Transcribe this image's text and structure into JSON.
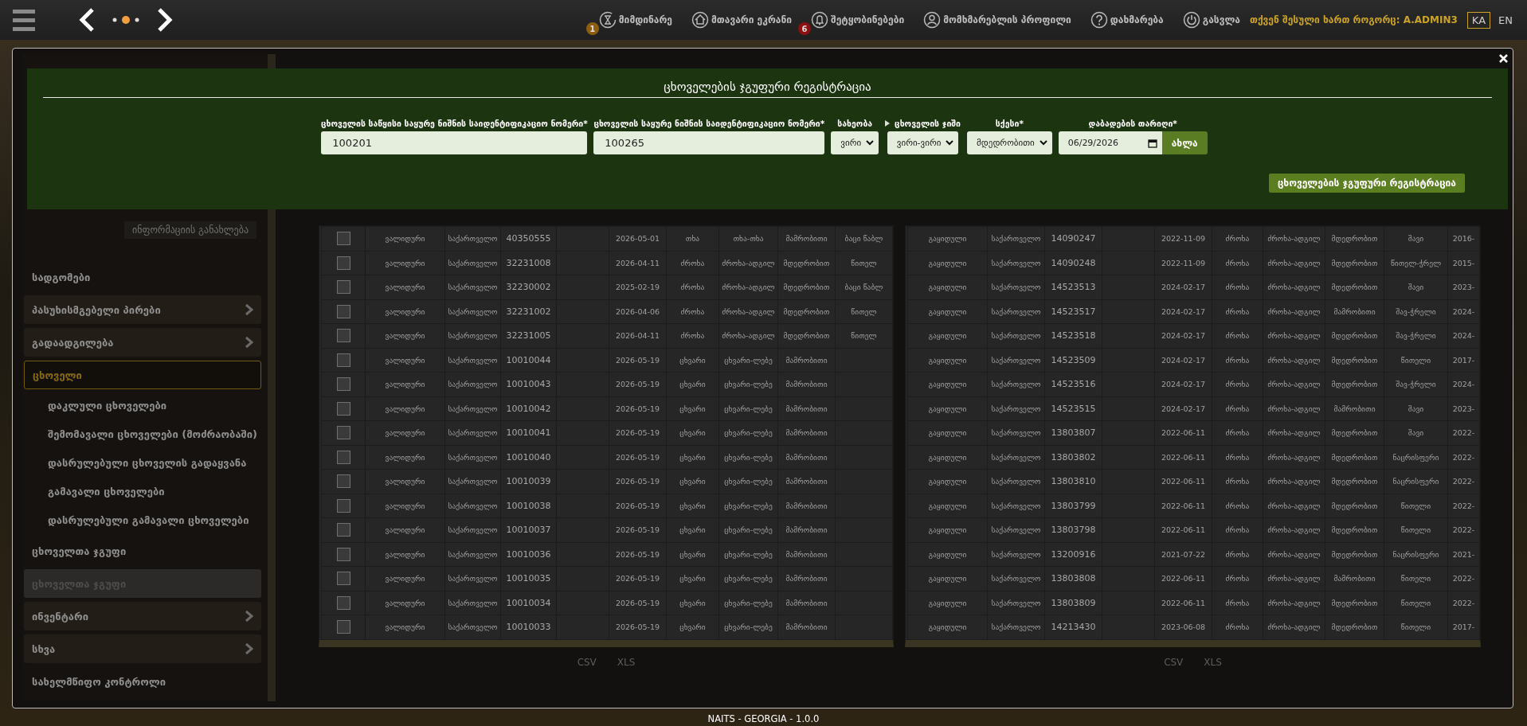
{
  "header": {
    "nav": [
      {
        "label": "მიმდინარე",
        "badge": {
          "text": "1",
          "color": "#8b5e12"
        }
      },
      {
        "label": "მთავარი ეკრანი"
      },
      {
        "label": "შეტყობინებები",
        "badge": {
          "text": "6",
          "color": "#8b1010"
        }
      },
      {
        "label": "მომხმარებლის პროფილი"
      },
      {
        "label": "დახმარება"
      },
      {
        "label": "გასვლა"
      }
    ],
    "login_label": "თქვენ შესული ხართ როგორც:",
    "username": "A.ADMIN3",
    "languages": [
      {
        "label": "KA",
        "selected": true
      },
      {
        "label": "EN",
        "selected": false
      }
    ]
  },
  "sidebar": {
    "update_button": "ინფორმაციის განახლება",
    "items": [
      {
        "kind": "header",
        "label": "სადგომები",
        "selected": false,
        "disabled": false
      },
      {
        "kind": "item",
        "label": "პასუხისმგებელი პირები",
        "selected": false,
        "disabled": false,
        "has_children": true
      },
      {
        "kind": "item",
        "label": "გადაადგილება",
        "selected": false,
        "disabled": false,
        "has_children": true
      },
      {
        "kind": "item",
        "label": "ცხოველი",
        "selected": true,
        "disabled": false,
        "has_children": false
      },
      {
        "kind": "subitem",
        "label": "დაკლული ცხოველები",
        "selected": false,
        "disabled": false
      },
      {
        "kind": "subitem",
        "label": "შემომავალი ცხოველები (მოძრაობაში)",
        "selected": false,
        "disabled": false
      },
      {
        "kind": "subitem",
        "label": "დასრულებული ცხოველის გადაყვანა",
        "selected": false,
        "disabled": false
      },
      {
        "kind": "subitem",
        "label": "გამავალი ცხოველები",
        "selected": false,
        "disabled": false
      },
      {
        "kind": "subitem",
        "label": "დასრულებული გამავალი ცხოველები",
        "selected": false,
        "disabled": false
      },
      {
        "kind": "header",
        "label": "ცხოველთა ჯგუფი",
        "selected": false,
        "disabled": false
      },
      {
        "kind": "item",
        "label": "ცხოველთა ჯგუფი",
        "selected": false,
        "disabled": true,
        "has_children": false
      },
      {
        "kind": "item",
        "label": "ინვენტარი",
        "selected": false,
        "disabled": false,
        "has_children": true
      },
      {
        "kind": "item",
        "label": "სხვა",
        "selected": false,
        "disabled": false,
        "has_children": true
      },
      {
        "kind": "header",
        "label": "სახელმწიფო კონტროლი",
        "selected": false,
        "disabled": false
      }
    ]
  },
  "left_table": {
    "rows": [
      {
        "checked": false,
        "cells": [
          "ვალიდური",
          "საქართველო",
          "40350555",
          "",
          "2026-05-01",
          "თხა",
          "თხა-თხა",
          "მამრობითი",
          "ბაცი წაბლ"
        ]
      },
      {
        "checked": false,
        "cells": [
          "ვალიდური",
          "საქართველო",
          "32231008",
          "",
          "2026-04-11",
          "ძროხა",
          "ძროხა-ადგილ",
          "მდედრობით",
          "წითელ"
        ]
      },
      {
        "checked": false,
        "cells": [
          "ვალიდური",
          "საქართველო",
          "32230002",
          "",
          "2025-02-19",
          "ძროხა",
          "ძროხა-ადგილ",
          "მდედრობით",
          "ბაცი წაბლ"
        ]
      },
      {
        "checked": false,
        "cells": [
          "ვალიდური",
          "საქართველო",
          "32231002",
          "",
          "2026-04-06",
          "ძროხა",
          "ძროხა-ადგილ",
          "მდედრობით",
          "წითელ"
        ]
      },
      {
        "checked": false,
        "cells": [
          "ვალიდური",
          "საქართველო",
          "32231005",
          "",
          "2026-04-11",
          "ძროხა",
          "ძროხა-ადგილ",
          "მდედრობით",
          "წითელ"
        ]
      },
      {
        "checked": false,
        "cells": [
          "ვალიდური",
          "საქართველო",
          "10010044",
          "",
          "2026-05-19",
          "ცხვარი",
          "ცხვარი-ლებე",
          "მამრობითი",
          ""
        ]
      },
      {
        "checked": false,
        "cells": [
          "ვალიდური",
          "საქართველო",
          "10010043",
          "",
          "2026-05-19",
          "ცხვარი",
          "ცხვარი-ლებე",
          "მამრობითი",
          ""
        ]
      },
      {
        "checked": false,
        "cells": [
          "ვალიდური",
          "საქართველო",
          "10010042",
          "",
          "2026-05-19",
          "ცხვარი",
          "ცხვარი-ლებე",
          "მამრობითი",
          ""
        ]
      },
      {
        "checked": false,
        "cells": [
          "ვალიდური",
          "საქართველო",
          "10010041",
          "",
          "2026-05-19",
          "ცხვარი",
          "ცხვარი-ლებე",
          "მამრობითი",
          ""
        ]
      },
      {
        "checked": false,
        "cells": [
          "ვალიდური",
          "საქართველო",
          "10010040",
          "",
          "2026-05-19",
          "ცხვარი",
          "ცხვარი-ლებე",
          "მამრობითი",
          ""
        ]
      },
      {
        "checked": false,
        "cells": [
          "ვალიდური",
          "საქართველო",
          "10010039",
          "",
          "2026-05-19",
          "ცხვარი",
          "ცხვარი-ლებე",
          "მამრობითი",
          ""
        ]
      },
      {
        "checked": false,
        "cells": [
          "ვალიდური",
          "საქართველო",
          "10010038",
          "",
          "2026-05-19",
          "ცხვარი",
          "ცხვარი-ლებე",
          "მამრობითი",
          ""
        ]
      },
      {
        "checked": false,
        "cells": [
          "ვალიდური",
          "საქართველო",
          "10010037",
          "",
          "2026-05-19",
          "ცხვარი",
          "ცხვარი-ლებე",
          "მამრობითი",
          ""
        ]
      },
      {
        "checked": false,
        "cells": [
          "ვალიდური",
          "საქართველო",
          "10010036",
          "",
          "2026-05-19",
          "ცხვარი",
          "ცხვარი-ლებე",
          "მამრობითი",
          ""
        ]
      },
      {
        "checked": false,
        "cells": [
          "ვალიდური",
          "საქართველო",
          "10010035",
          "",
          "2026-05-19",
          "ცხვარი",
          "ცხვარი-ლებე",
          "მამრობითი",
          ""
        ]
      },
      {
        "checked": false,
        "cells": [
          "ვალიდური",
          "საქართველო",
          "10010034",
          "",
          "2026-05-19",
          "ცხვარი",
          "ცხვარი-ლებე",
          "მამრობითი",
          ""
        ]
      },
      {
        "checked": false,
        "cells": [
          "ვალიდური",
          "საქართველო",
          "10010033",
          "",
          "2026-05-19",
          "ცხვარი",
          "ცხვარი-ლებე",
          "მამრობითი",
          ""
        ]
      }
    ],
    "exports": [
      "CSV",
      "XLS"
    ]
  },
  "right_table": {
    "rows": [
      {
        "cells": [
          "გაყიდული",
          "საქართველო",
          "14090247",
          "",
          "2022-11-09",
          "ძროხა",
          "ძროხა-ადგილ",
          "მდედრობით",
          "შავი",
          "2016-"
        ]
      },
      {
        "cells": [
          "გაყიდული",
          "საქართველო",
          "14090248",
          "",
          "2022-11-09",
          "ძროხა",
          "ძროხა-ადგილ",
          "მდედრობით",
          "წითელ-ჭრელ",
          "2015-"
        ]
      },
      {
        "cells": [
          "გაყიდული",
          "საქართველო",
          "14523513",
          "",
          "2024-02-17",
          "ძროხა",
          "ძროხა-ადგილ",
          "მდედრობით",
          "შავი",
          "2023-"
        ]
      },
      {
        "cells": [
          "გაყიდული",
          "საქართველო",
          "14523517",
          "",
          "2024-02-17",
          "ძროხა",
          "ძროხა-ადგილ",
          "მამრობითი",
          "შავ-ჭრელი",
          "2024-"
        ]
      },
      {
        "cells": [
          "გაყიდული",
          "საქართველო",
          "14523518",
          "",
          "2024-02-17",
          "ძროხა",
          "ძროხა-ადგილ",
          "მდედრობით",
          "შავ-ჭრელი",
          "2024-"
        ]
      },
      {
        "cells": [
          "გაყიდული",
          "საქართველო",
          "14523509",
          "",
          "2024-02-17",
          "ძროხა",
          "ძროხა-ადგილ",
          "მდედრობით",
          "წითელი",
          "2017-"
        ]
      },
      {
        "cells": [
          "გაყიდული",
          "საქართველო",
          "14523516",
          "",
          "2024-02-17",
          "ძროხა",
          "ძროხა-ადგილ",
          "მდედრობით",
          "შავ-ჭრელი",
          "2024-"
        ]
      },
      {
        "cells": [
          "გაყიდული",
          "საქართველო",
          "14523515",
          "",
          "2024-02-17",
          "ძროხა",
          "ძროხა-ადგილ",
          "მამრობითი",
          "შავი",
          "2023-"
        ]
      },
      {
        "cells": [
          "გაყიდული",
          "საქართველო",
          "13803807",
          "",
          "2022-06-11",
          "ძროხა",
          "ძროხა-ადგილ",
          "მდედრობით",
          "შავი",
          "2022-"
        ]
      },
      {
        "cells": [
          "გაყიდული",
          "საქართველო",
          "13803802",
          "",
          "2022-06-11",
          "ძროხა",
          "ძროხა-ადგილ",
          "მდედრობით",
          "ნაცრისფერი",
          "2022-"
        ]
      },
      {
        "cells": [
          "გაყიდული",
          "საქართველო",
          "13803810",
          "",
          "2022-06-11",
          "ძროხა",
          "ძროხა-ადგილ",
          "მდედრობით",
          "ნაცრისფერი",
          "2022-"
        ]
      },
      {
        "cells": [
          "გაყიდული",
          "საქართველო",
          "13803799",
          "",
          "2022-06-11",
          "ძროხა",
          "ძროხა-ადგილ",
          "მდედრობით",
          "წითელი",
          "2022-"
        ]
      },
      {
        "cells": [
          "გაყიდული",
          "საქართველო",
          "13803798",
          "",
          "2022-06-11",
          "ძროხა",
          "ძროხა-ადგილ",
          "მდედრობით",
          "წითელი",
          "2022-"
        ]
      },
      {
        "cells": [
          "გაყიდული",
          "საქართველო",
          "13200916",
          "",
          "2021-07-22",
          "ძროხა",
          "ძროხა-ადგილ",
          "მდედრობით",
          "ნაცრისფერი",
          "2021-"
        ]
      },
      {
        "cells": [
          "გაყიდული",
          "საქართველო",
          "13803808",
          "",
          "2022-06-11",
          "ძროხა",
          "ძროხა-ადგილ",
          "მამრობითი",
          "წითელი",
          "2022-"
        ]
      },
      {
        "cells": [
          "გაყიდული",
          "საქართველო",
          "13803809",
          "",
          "2022-06-11",
          "ძროხა",
          "ძროხა-ადგილ",
          "მდედრობით",
          "წითელი",
          "2022-"
        ]
      },
      {
        "cells": [
          "გაყიდული",
          "საქართველო",
          "14213430",
          "",
          "2023-06-08",
          "ძროხა",
          "ძროხა-ადგილ",
          "მდედრობით",
          "წითელი",
          "2017-"
        ]
      }
    ],
    "exports": [
      "CSV",
      "XLS"
    ]
  },
  "dialog": {
    "title": "ცხოველების ჯგუფური რეგისტრაცია",
    "fields": [
      {
        "kind": "text",
        "label": "ცხოველის საწყისი საყურე ნიშნის საიდენტიფიკაციო ნომერი*",
        "value": "100201",
        "expander": false
      },
      {
        "kind": "text",
        "label": "ცხოველის საყურე ნიშნის საიდენტიფიკაციო ნომერი*",
        "value": "100265",
        "expander": false
      },
      {
        "kind": "select",
        "label": "სახეობა",
        "value": "ვირი",
        "expander": false
      },
      {
        "kind": "select",
        "label": "ცხოველის ჯიში",
        "value": "ვირი-ვირი",
        "expander": true
      },
      {
        "kind": "select",
        "label": "სქესი*",
        "value": "მდედრობითი",
        "expander": false
      },
      {
        "kind": "date",
        "label": "დაბადების თარიღი*",
        "value": "06/29/2026",
        "button": "ახლა",
        "expander": false
      }
    ],
    "submit": "ცხოველების ჯგუფური რეგისტრაცია"
  },
  "footer": "NAITS - GEORGIA - 1.0.0"
}
